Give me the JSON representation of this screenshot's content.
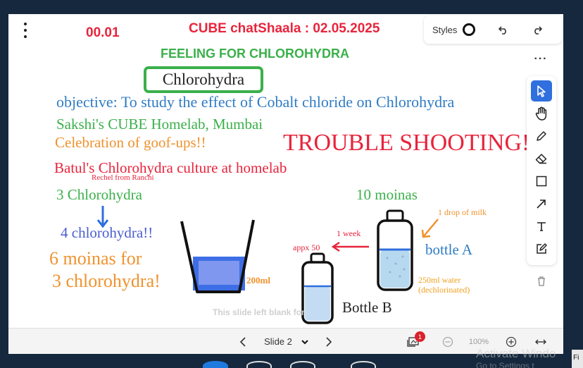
{
  "toolbar_top": {
    "styles_label": "Styles"
  },
  "slide": {
    "timer": "00.01",
    "header": "CUBE chatShaala : 02.05.2025",
    "feeling": "FEELING FOR CHLOROHYDRA",
    "title_box": "Chlorohydra",
    "objective": "objective: To study the effect of Cobalt chloride on Chlorohydra",
    "homelab": "Sakshi's CUBE Homelab, Mumbai",
    "celebration": "Celebration of goof-ups!!",
    "troubleshooting": "TROUBLE SHOOTING!",
    "batul": "Batul's Chlorohydra culture at homelab",
    "rechel": "Rechel from Ranchi",
    "three_chloro": "3 Chlorohydra",
    "four_chloro": "4 chlorohydra!!",
    "moinas_line1": "6 moinas for",
    "moinas_line2": "3 chlorohydra!",
    "beaker_volume": "200ml",
    "ten_moinas": "10 moinas",
    "milk_drop": "1 drop of milk",
    "one_week": "1 week",
    "appx": "appx 50",
    "bottle_a": "bottle A",
    "water_line1": "250ml water",
    "water_line2": "(dechlorinated)",
    "bottle_b": "Bottle B",
    "blank_note": "This slide left blank for"
  },
  "bottom_bar": {
    "slide_selector": "Slide 2",
    "notification_count": "1",
    "zoom": "100%"
  },
  "os": {
    "watermark_title": "Activate Windo",
    "watermark_sub": "Go to Settings t",
    "tray_label": "Fi"
  },
  "colors": {
    "red": "#e8243c",
    "green": "#3bb04b",
    "blue": "#2f7cc4",
    "orange": "#f0922e",
    "indigo": "#4a5ed0",
    "accent": "#2f6fde",
    "background": "#15283d"
  },
  "icons": {
    "menu": "vertical-dots-icon",
    "undo": "undo-icon",
    "redo": "redo-icon",
    "more": "horizontal-dots-icon",
    "select": "cursor-icon",
    "pan": "hand-icon",
    "pen": "pen-icon",
    "eraser": "eraser-icon",
    "rectangle": "rectangle-icon",
    "arrow": "arrow-icon",
    "text": "text-icon",
    "edit": "edit-note-icon",
    "delete": "trash-icon",
    "prev": "chevron-left-icon",
    "next": "chevron-right-icon",
    "dropdown": "chevron-down-icon",
    "presenters": "presenter-icon",
    "zoom_out": "zoom-out-icon",
    "zoom_in": "zoom-in-icon",
    "fit": "fit-width-icon"
  }
}
